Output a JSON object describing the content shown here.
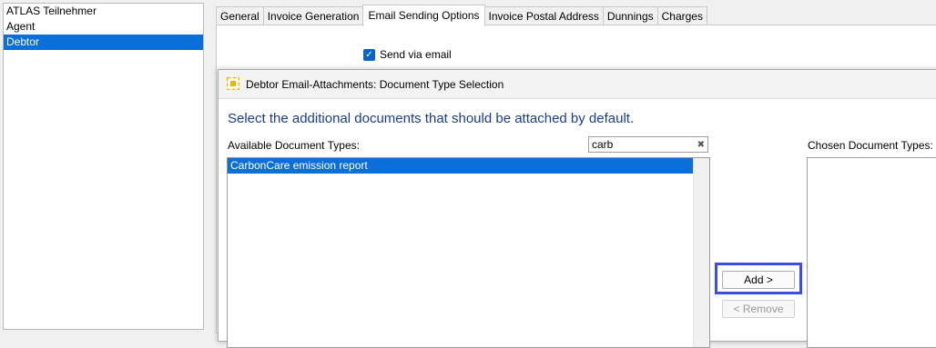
{
  "tree": {
    "items": [
      {
        "label": "ATLAS Teilnehmer",
        "selected": false
      },
      {
        "label": "Agent",
        "selected": false
      },
      {
        "label": "Debtor",
        "selected": true
      }
    ]
  },
  "tabs": [
    {
      "label": "General",
      "active": false
    },
    {
      "label": "Invoice Generation",
      "active": false
    },
    {
      "label": "Email Sending Options",
      "active": true
    },
    {
      "label": "Invoice Postal Address",
      "active": false
    },
    {
      "label": "Dunnings",
      "active": false
    },
    {
      "label": "Charges",
      "active": false
    }
  ],
  "email_options": {
    "send_via_email_label": "Send via email",
    "send_via_email_checked": true
  },
  "dialog": {
    "title": "Debtor Email-Attachments: Document Type Selection",
    "heading": "Select the additional documents that should be attached by default.",
    "available_label": "Available Document Types:",
    "chosen_label": "Chosen Document Types:",
    "filter_value": "carb",
    "available_items": [
      {
        "label": "CarbonCare emission report",
        "selected": true
      }
    ],
    "chosen_items": [],
    "add_button": "Add >",
    "remove_button": "< Remove"
  },
  "colors": {
    "selection": "#0a6fd8",
    "heading": "#1a3e8c",
    "highlight": "#3a4ee0"
  }
}
